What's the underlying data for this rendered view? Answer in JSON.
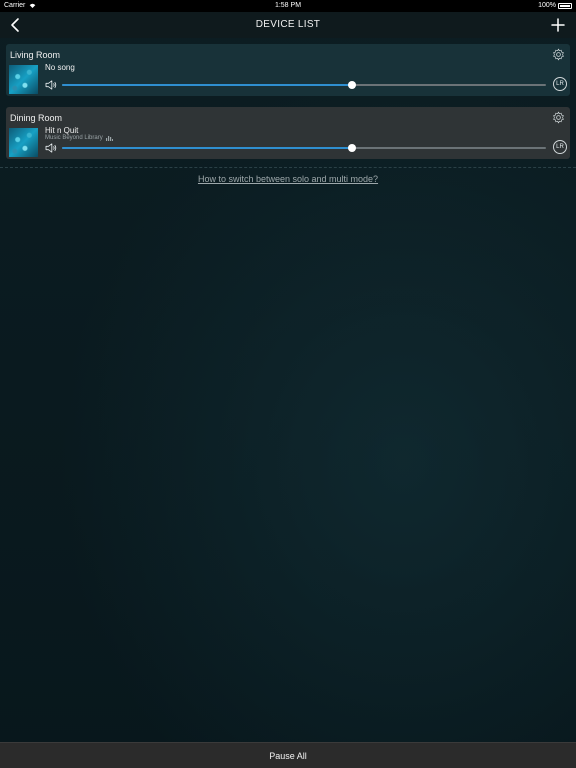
{
  "status_bar": {
    "carrier": "Carrier",
    "time": "1:58 PM",
    "battery": "100%"
  },
  "nav": {
    "title": "DEVICE LIST",
    "back_icon": "chevron-left-icon",
    "add_icon": "plus-icon"
  },
  "devices": [
    {
      "name": "Living Room",
      "song": "No song",
      "source": "",
      "volume": 0.6,
      "channel": "LR",
      "selected": true
    },
    {
      "name": "Dining Room",
      "song": "Hit n Quit",
      "source": "Music Beyond Library",
      "volume": 0.6,
      "channel": "LR",
      "selected": false
    }
  ],
  "help_link": "How to switch between solo and multi mode?",
  "bottom": {
    "pause_all": "Pause All"
  },
  "colors": {
    "accent": "#2f8fd0",
    "selected_bg": "#1c3a42",
    "card_bg": "#2f3436"
  }
}
